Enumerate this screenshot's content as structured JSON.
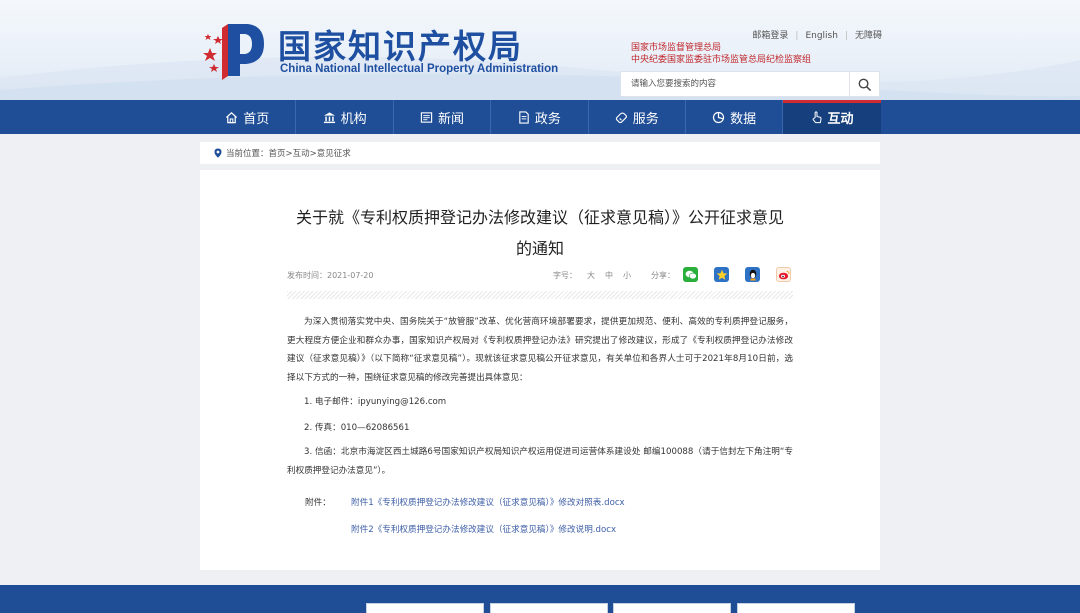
{
  "header": {
    "site_name_cn": "国家知识产权局",
    "site_name_en": "China National Intellectual Property Administration",
    "top_links": [
      "邮箱登录",
      "English",
      "无障碍"
    ],
    "orgs": [
      "国家市场监督管理总局",
      "中央纪委国家监委驻市场监管总局纪检监察组"
    ],
    "search_placeholder": "请输入您要搜索的内容"
  },
  "nav": {
    "items": [
      {
        "label": "首页",
        "icon": "home-icon"
      },
      {
        "label": "机构",
        "icon": "institution-icon"
      },
      {
        "label": "新闻",
        "icon": "news-icon"
      },
      {
        "label": "政务",
        "icon": "document-icon"
      },
      {
        "label": "服务",
        "icon": "service-icon"
      },
      {
        "label": "数据",
        "icon": "data-chart-icon"
      },
      {
        "label": "互动",
        "icon": "hand-pointer-icon"
      }
    ],
    "active": "互动"
  },
  "breadcrumb": {
    "text": "当前位置：首页>互动>意见征求"
  },
  "article": {
    "title_line1": "关于就《专利权质押登记办法修改建议（征求意见稿）》公开征求意见",
    "title_line2": "的通知",
    "date": "发布时间：2021-07-20",
    "font_size_label": "字号：",
    "font_sizes": [
      "大",
      "中",
      "小"
    ],
    "share_label": "分享：",
    "paragraph": "为深入贯彻落实党中央、国务院关于“放管服”改革、优化营商环境部署要求，提供更加规范、便利、高效的专利质押登记服务，更大程度方便企业和群众办事，国家知识产权局对《专利权质押登记办法》研究提出了修改建议，形成了《专利权质押登记办法修改建议（征求意见稿）》（以下简称“征求意见稿”）。现就该征求意见稿公开征求意见，有关单位和各界人士可于2021年8月10日前，选择以下方式的一种，围绕征求意见稿的修改完善提出具体意见：",
    "items": [
      "1. 电子邮件：ipyunying@126.com",
      "2. 传真：010—62086561",
      "3. 信函：北京市海淀区西土城路6号国家知识产权局知识产权运用促进司运营体系建设处 邮编100088（请于信封左下角注明“专利权质押登记办法意见”）。"
    ],
    "attachment_label": "附件：",
    "attachments": [
      "附件1《专利权质押登记办法修改建议（征求意见稿）》修改对照表.docx",
      "附件2《专利权质押登记办法修改建议（征求意见稿）》修改说明.docx"
    ]
  },
  "colors": {
    "brand_blue": "#1f4e96",
    "accent_red": "#d02b31",
    "link_blue": "#3e5fa6"
  }
}
